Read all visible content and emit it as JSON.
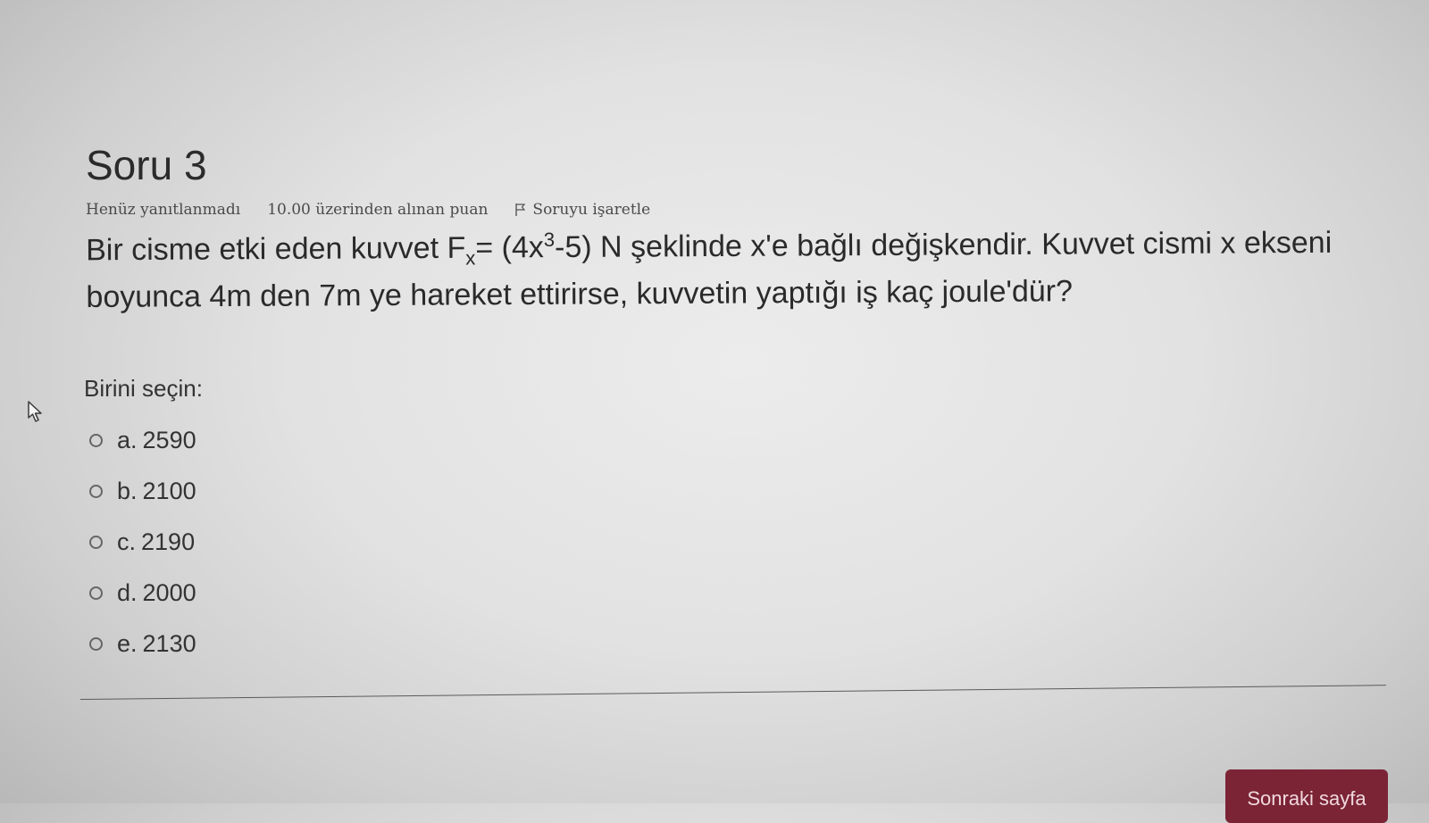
{
  "question": {
    "title": "Soru 3",
    "status": "Henüz yanıtlanmadı",
    "grade": "10.00 üzerinden alınan puan",
    "flag_label": "Soruyu işaretle",
    "text_part1": "Bir cisme etki eden kuvvet F",
    "text_sub": "x",
    "text_part2": "= (4x",
    "text_sup": "3",
    "text_part3": "-5) N şeklinde x'e bağlı değişkendir. Kuvvet cismi x ekseni boyunca 4m den 7m ye hareket ettirirse, kuvvetin yaptığı iş kaç joule'dür?"
  },
  "answers": {
    "prompt": "Birini seçin:",
    "options": [
      {
        "letter": "a.",
        "value": "2590"
      },
      {
        "letter": "b.",
        "value": "2100"
      },
      {
        "letter": "c.",
        "value": "2190"
      },
      {
        "letter": "d.",
        "value": "2000"
      },
      {
        "letter": "e.",
        "value": "2130"
      }
    ]
  },
  "navigation": {
    "next_label": "Sonraki sayfa"
  },
  "colors": {
    "button_bg": "#7b2436",
    "text": "#2a2a2a"
  },
  "icons": {
    "flag": "flag-icon",
    "cursor": "mouse-pointer-icon",
    "radio": "radio-unchecked-icon"
  }
}
